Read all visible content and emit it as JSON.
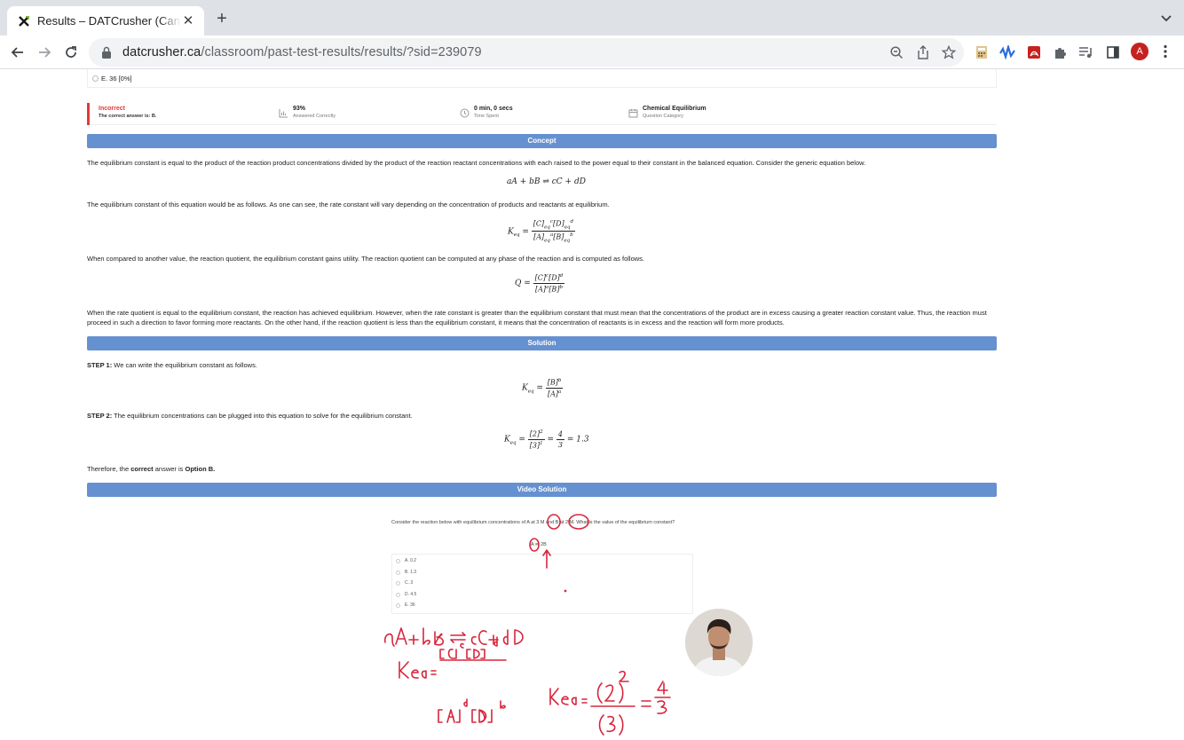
{
  "browser": {
    "tab_title": "Results – DATCrusher (Canadian)",
    "url_host": "datcrusher.ca",
    "url_path": "/classroom/past-test-results/results/?sid=239079",
    "profile_initial": "A"
  },
  "question": {
    "last_option": "E. 36 [0%]"
  },
  "stats": {
    "status": "Incorrect",
    "correct_answer": "The correct answer is: B.",
    "percent": "93%",
    "percent_label": "Answered Correctly",
    "time": "0 min, 0 secs",
    "time_label": "Time Spent",
    "category": "Chemical Equilibrium",
    "category_label": "Question Category"
  },
  "concept": {
    "header": "Concept",
    "p1": "The equilibrium constant is equal to the product of the reaction product concentrations divided by the product of the reaction reactant concentrations with each raised to the power equal to their constant in the balanced equation. Consider the generic equation below.",
    "p2": "The equilibrium constant of this equation would be as follows. As one can see, the rate constant will vary depending on the concentration of products and reactants at equilibrium.",
    "p3": "When compared to another value, the reaction quotient, the equilibrium constant gains utility. The reaction quotient can be computed at any phase of the reaction and is computed as follows.",
    "p4": "When the rate quotient is equal to the equilibrium constant, the reaction has achieved equilibrium. However, when the rate constant is greater than the equilibrium constant that must mean that the concentrations of the product are in excess causing a greater reaction constant value. Thus, the reaction must proceed in such a direction to favor forming more reactants. On the other hand, if the reaction quotient is less than the equilibrium constant, it means that the concentration of reactants is in excess and the reaction will form more products."
  },
  "solution": {
    "header": "Solution",
    "step1_label": "STEP 1:",
    "step1": " We can write the equilibrium constant as follows.",
    "step2_label": "STEP 2:",
    "step2": " The equilibrium concentrations can be plugged into this equation to solve for the equilibrium constant.",
    "final_pre": "Therefore, the ",
    "final_bold": "correct",
    "final_mid": " answer is ",
    "final_option": "Option B."
  },
  "video": {
    "header": "Video Solution",
    "question": "Consider the reaction below with equilibrium concentrations of A at 3 M and B at 2 M. What is the value of the equilibrium constant?",
    "reaction": "A ⇌ 2B",
    "options": [
      "A. 0.2",
      "B. 1.3",
      "C. 3",
      "D. 4.5",
      "E. 36"
    ]
  },
  "colors": {
    "section_bar": "#6591d0",
    "incorrect": "#e53935",
    "ink": "#d7263d"
  }
}
